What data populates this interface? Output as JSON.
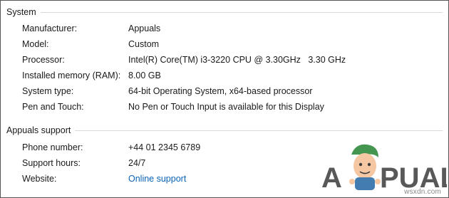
{
  "system": {
    "heading": "System",
    "rows": [
      {
        "label": "Manufacturer:",
        "value": "Appuals"
      },
      {
        "label": "Model:",
        "value": "Custom"
      },
      {
        "label": "Processor:",
        "value": "Intel(R) Core(TM) i3-3220 CPU @ 3.30GHz   3.30 GHz"
      },
      {
        "label": "Installed memory (RAM):",
        "value": "8.00 GB"
      },
      {
        "label": "System type:",
        "value": "64-bit Operating System, x64-based processor"
      },
      {
        "label": "Pen and Touch:",
        "value": "No Pen or Touch Input is available for this Display"
      }
    ]
  },
  "support": {
    "heading": "Appuals support",
    "rows": [
      {
        "label": "Phone number:",
        "value": "+44 01 2345 6789"
      },
      {
        "label": "Support hours:",
        "value": "24/7"
      },
      {
        "label": "Website:",
        "value": "Online support"
      }
    ]
  },
  "watermark": {
    "logo_text": "APPUALS",
    "site": "wsxdn.com"
  },
  "colors": {
    "link": "#0b63b6",
    "rule": "#d9d9d9",
    "text": "#1a1a1a",
    "watermark_text": "#3b3b3b",
    "watermark_mascot_skin": "#f4c39a",
    "watermark_mascot_hair": "#2f8a3c"
  }
}
